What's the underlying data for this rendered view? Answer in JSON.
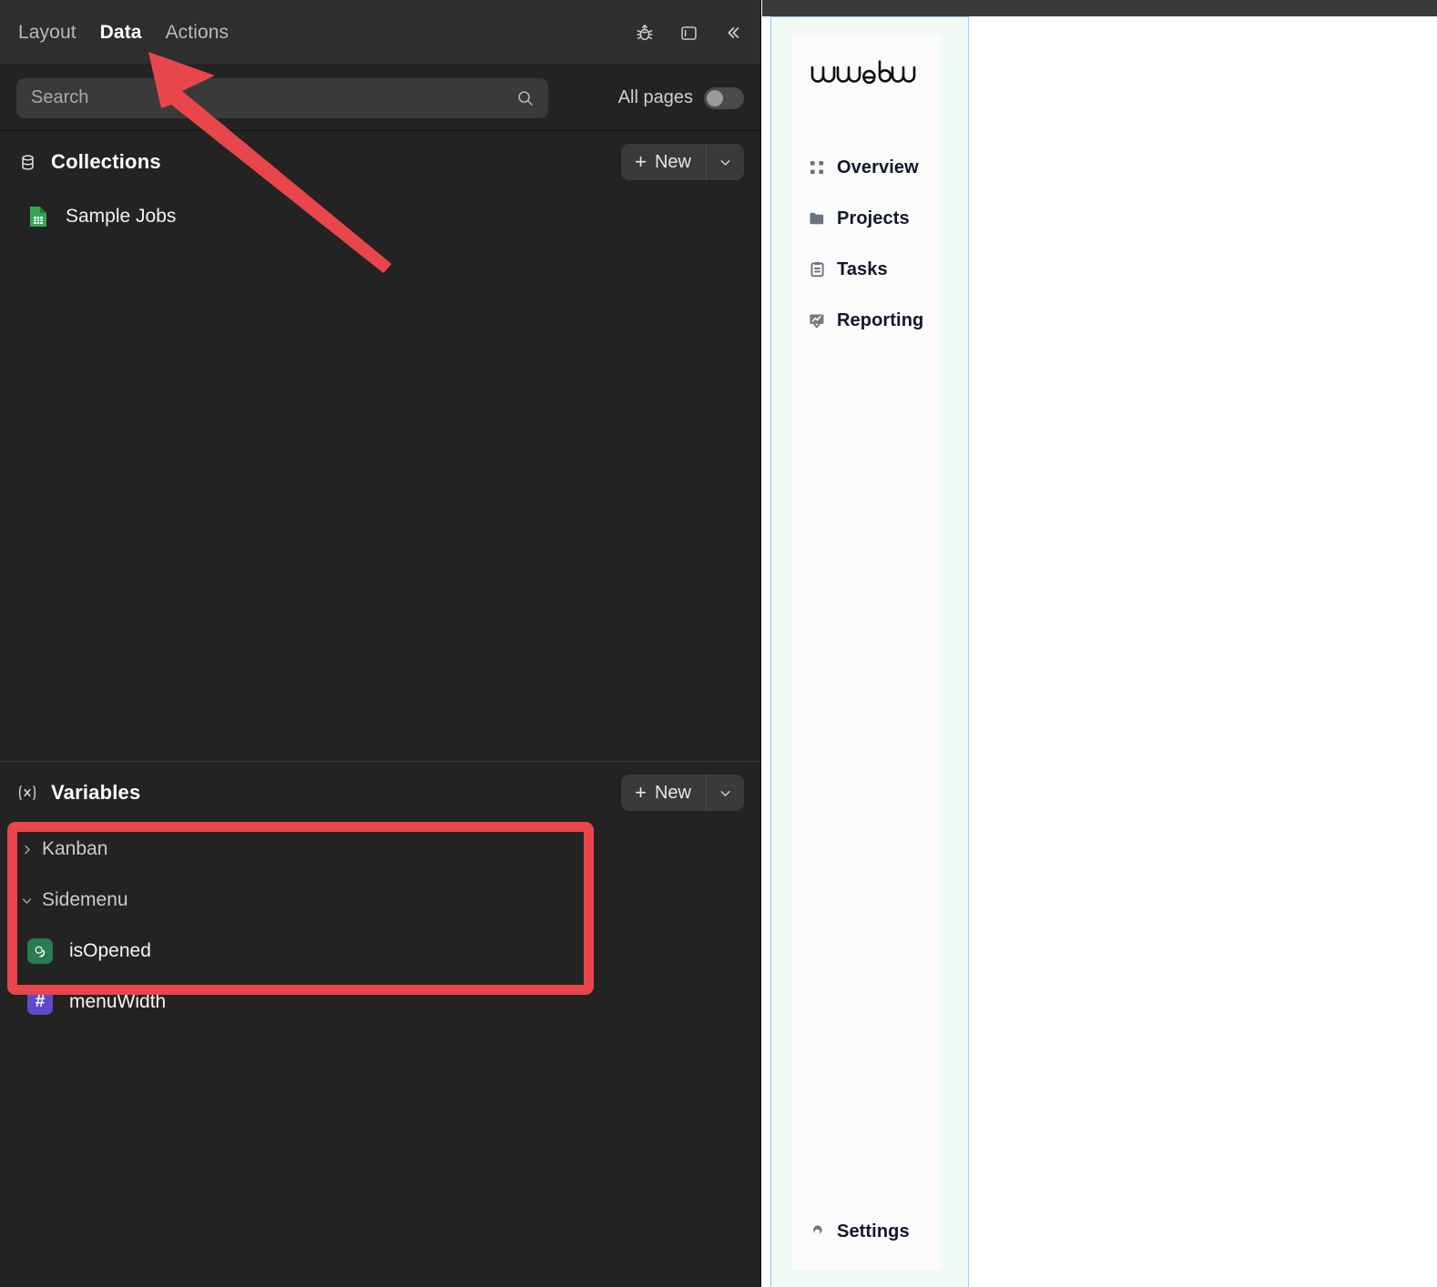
{
  "editor": {
    "tabs": [
      {
        "label": "Layout",
        "active": false
      },
      {
        "label": "Data",
        "active": true
      },
      {
        "label": "Actions",
        "active": false
      }
    ],
    "header_icons": [
      {
        "name": "bug-icon",
        "title": "Debug"
      },
      {
        "name": "panel-layout-icon",
        "title": "Toggle panel"
      },
      {
        "name": "collapse-left-icon",
        "title": "Collapse"
      }
    ],
    "search": {
      "placeholder": "Search",
      "value": "",
      "icon": "search-icon"
    },
    "all_pages": {
      "label": "All pages",
      "enabled": false
    },
    "collections": {
      "title": "Collections",
      "icon": "database-icon",
      "new_label": "New",
      "new_plus": "+",
      "caret": "⌄",
      "items": [
        {
          "label": "Sample Jobs",
          "icon": "google-sheets-icon"
        }
      ]
    },
    "variables": {
      "title": "Variables",
      "icon": "variable-fx-icon",
      "new_label": "New",
      "new_plus": "+",
      "caret": "⌄",
      "groups": [
        {
          "label": "Kanban",
          "expanded": false,
          "chevron": "›",
          "items": []
        },
        {
          "label": "Sidemenu",
          "expanded": true,
          "chevron": "⌄",
          "highlighted": true,
          "items": [
            {
              "label": "isOpened",
              "type": "boolean",
              "badge": "toggle-icon",
              "color": "#2a7a52"
            },
            {
              "label": "menuWidth",
              "type": "number",
              "badge": "#",
              "color": "#5c4ccc"
            }
          ]
        }
      ]
    },
    "annotations": {
      "arrow_color": "#e8464a",
      "box_color": "#e8464a",
      "arrow_points_to": "Data"
    }
  },
  "preview": {
    "brand": "weweb",
    "nav_items": [
      {
        "label": "Overview",
        "icon": "grid-dots-icon"
      },
      {
        "label": "Projects",
        "icon": "folder-icon"
      },
      {
        "label": "Tasks",
        "icon": "clipboard-icon"
      },
      {
        "label": "Reporting",
        "icon": "chart-presentation-icon"
      }
    ],
    "bottom_items": [
      {
        "label": "Settings",
        "icon": "gear-icon"
      }
    ],
    "selection_border_color": "#9ecbf0",
    "container_bg": "#f0faf4"
  }
}
